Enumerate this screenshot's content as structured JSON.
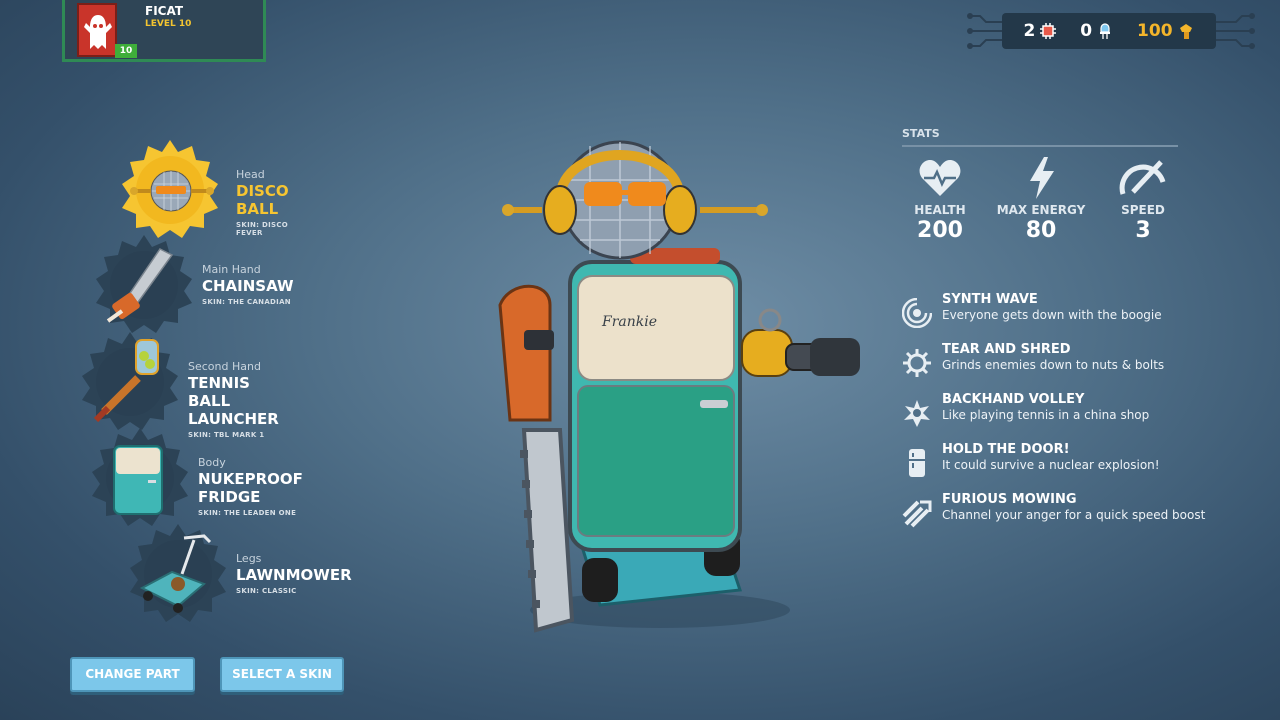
{
  "player": {
    "name": "FICAT",
    "level_text": "LEVEL 10",
    "level_badge": "10"
  },
  "currency": {
    "chips": "2",
    "bulbs": "0",
    "bolts": "100"
  },
  "parts": [
    {
      "slot": "Head",
      "name": "DISCO BALL",
      "skin": "SKIN: DISCO FEVER",
      "selected": true
    },
    {
      "slot": "Main Hand",
      "name": "CHAINSAW",
      "skin": "SKIN: THE CANADIAN"
    },
    {
      "slot": "Second Hand",
      "name": "TENNIS BALL LAUNCHER",
      "skin": "SKIN: TBL MARK 1"
    },
    {
      "slot": "Body",
      "name": "NUKEPROOF FRIDGE",
      "skin": "SKIN: THE LEADEN ONE"
    },
    {
      "slot": "Legs",
      "name": "LAWNMOWER",
      "skin": "SKIN: CLASSIC"
    }
  ],
  "buttons": {
    "change_part": "CHANGE PART",
    "select_skin": "SELECT A SKIN"
  },
  "robot": {
    "fridge_logo": "Frankie"
  },
  "stats": {
    "title": "STATS",
    "items": [
      {
        "label": "HEALTH",
        "value": "200",
        "icon": "heart-icon"
      },
      {
        "label": "MAX ENERGY",
        "value": "80",
        "icon": "lightning-icon"
      },
      {
        "label": "SPEED",
        "value": "3",
        "icon": "speedometer-icon"
      }
    ]
  },
  "abilities": [
    {
      "name": "SYNTH WAVE",
      "desc": "Everyone gets down with the boogie",
      "icon": "sound-wave-icon"
    },
    {
      "name": "TEAR AND SHRED",
      "desc": "Grinds enemies down to nuts & bolts",
      "icon": "saw-blade-icon"
    },
    {
      "name": "BACKHAND VOLLEY",
      "desc": "Like playing tennis in a china shop",
      "icon": "tennis-impact-icon"
    },
    {
      "name": "HOLD THE DOOR!",
      "desc": "It could survive a nuclear explosion!",
      "icon": "fridge-icon"
    },
    {
      "name": "FURIOUS MOWING",
      "desc": "Channel your anger for a quick speed boost",
      "icon": "speed-claw-icon"
    }
  ],
  "colors": {
    "accent_yellow": "#f6c531",
    "button_blue": "#7cc7ea",
    "player_green": "#2f8a55"
  }
}
